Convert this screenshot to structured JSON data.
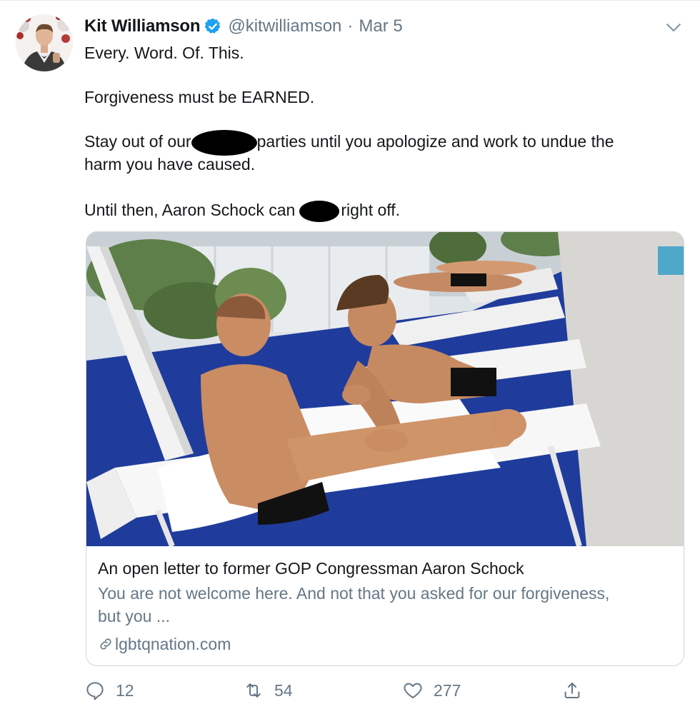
{
  "tweet": {
    "author_name": "Kit Williamson",
    "handle": "@kitwilliamson",
    "separator": "·",
    "date": "Mar 5",
    "lines": {
      "l1": "Every. Word. Of. This.",
      "l2": "Forgiveness must be EARNED.",
      "l3a": "Stay out of our",
      "l3b": "parties until you apologize and work to undue the",
      "l4": "harm you have caused.",
      "l5a": "Until then, Aaron Schock can",
      "l5b": "right off."
    }
  },
  "card": {
    "title": "An open letter to former GOP Congressman Aaron Schock",
    "description_line1": "You are not welcome here. And not that you asked for our forgiveness,",
    "description_line2": "but you ...",
    "domain": "lgbtqnation.com"
  },
  "actions": {
    "reply_count": "12",
    "retweet_count": "54",
    "like_count": "277"
  },
  "icons": {
    "verified": "verified-badge-icon",
    "more": "chevron-down-icon",
    "link": "link-icon",
    "reply": "reply-icon",
    "retweet": "retweet-icon",
    "like": "heart-icon",
    "share": "share-icon"
  },
  "colors": {
    "text_primary": "#14171a",
    "text_secondary": "#657786",
    "verified_blue": "#1da1f2",
    "border": "#ccd6dd"
  }
}
